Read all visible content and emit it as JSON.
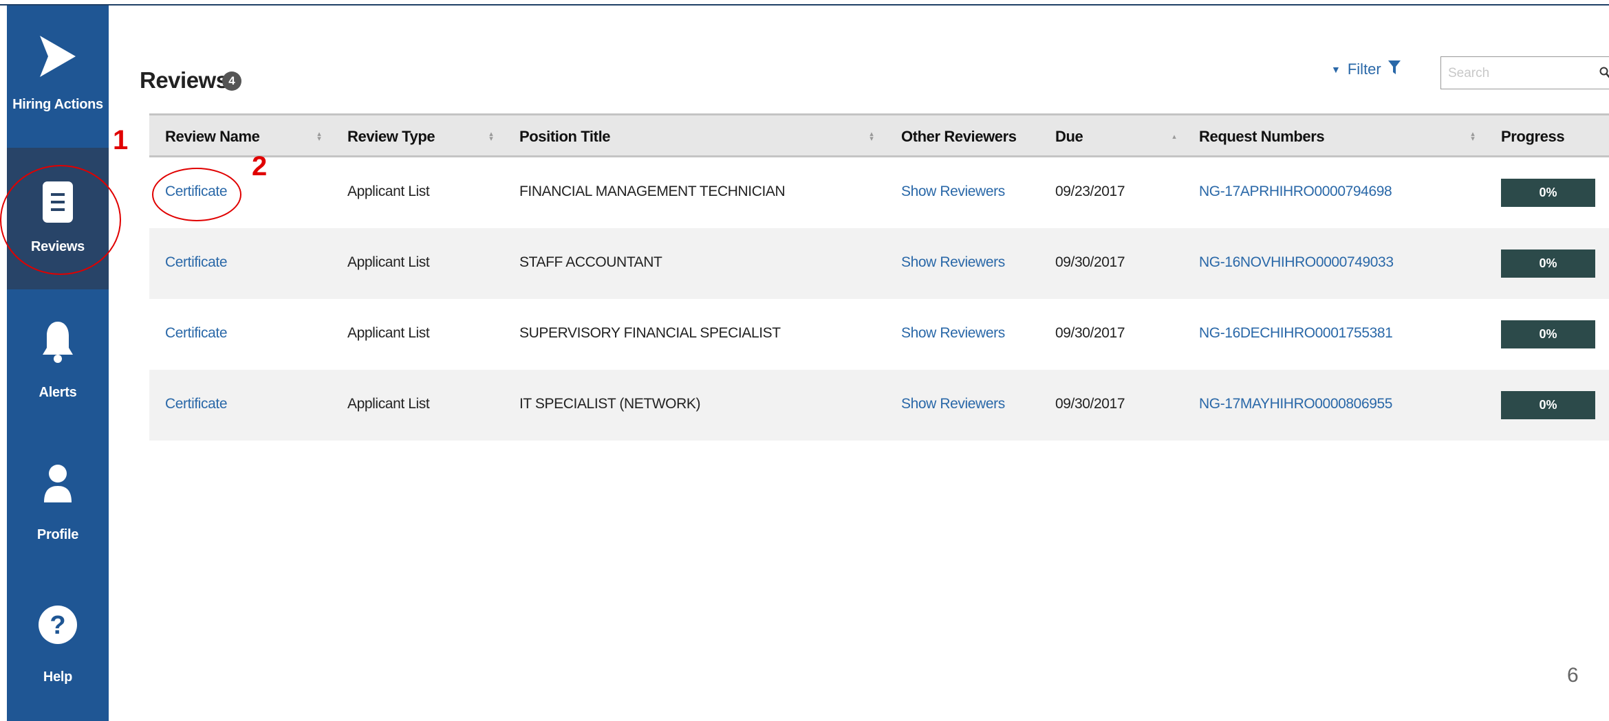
{
  "sidebar": {
    "items": [
      {
        "label": "Hiring Actions",
        "icon": "paper-plane-icon",
        "active": false
      },
      {
        "label": "Reviews",
        "icon": "document-icon",
        "active": true
      },
      {
        "label": "Alerts",
        "icon": "bell-icon",
        "active": false
      },
      {
        "label": "Profile",
        "icon": "person-icon",
        "active": false
      },
      {
        "label": "Help",
        "icon": "question-icon",
        "active": false
      }
    ]
  },
  "main": {
    "title": "Reviews",
    "count": "4",
    "filter_label": "Filter",
    "search_placeholder": "Search"
  },
  "table": {
    "headers": [
      "Review Name",
      "Review Type",
      "Position Title",
      "Other Reviewers",
      "Due",
      "Request Numbers",
      "Progress"
    ],
    "rows": [
      {
        "review_name": "Certificate",
        "review_type": "Applicant List",
        "position_title": "FINANCIAL MANAGEMENT TECHNICIAN",
        "other_reviewers": "Show Reviewers",
        "due": "09/23/2017",
        "request_number": "NG-17APRHIHRO0000794698",
        "progress": "0%"
      },
      {
        "review_name": "Certificate",
        "review_type": "Applicant List",
        "position_title": "STAFF ACCOUNTANT",
        "other_reviewers": "Show Reviewers",
        "due": "09/30/2017",
        "request_number": "NG-16NOVHIHRO0000749033",
        "progress": "0%"
      },
      {
        "review_name": "Certificate",
        "review_type": "Applicant List",
        "position_title": "SUPERVISORY FINANCIAL SPECIALIST",
        "other_reviewers": "Show Reviewers",
        "due": "09/30/2017",
        "request_number": "NG-16DECHIHRO0001755381",
        "progress": "0%"
      },
      {
        "review_name": "Certificate",
        "review_type": "Applicant List",
        "position_title": "IT SPECIALIST (NETWORK)",
        "other_reviewers": "Show Reviewers",
        "due": "09/30/2017",
        "request_number": "NG-17MAYHIHRO0000806955",
        "progress": "0%"
      }
    ]
  },
  "annotations": {
    "step1": "1",
    "step2": "2"
  },
  "page_number": "6",
  "colors": {
    "sidebar": "#1f5694",
    "sidebar_active": "#284468",
    "link": "#2a68a8",
    "progress": "#2c4a4a",
    "annotation": "#e00000"
  }
}
